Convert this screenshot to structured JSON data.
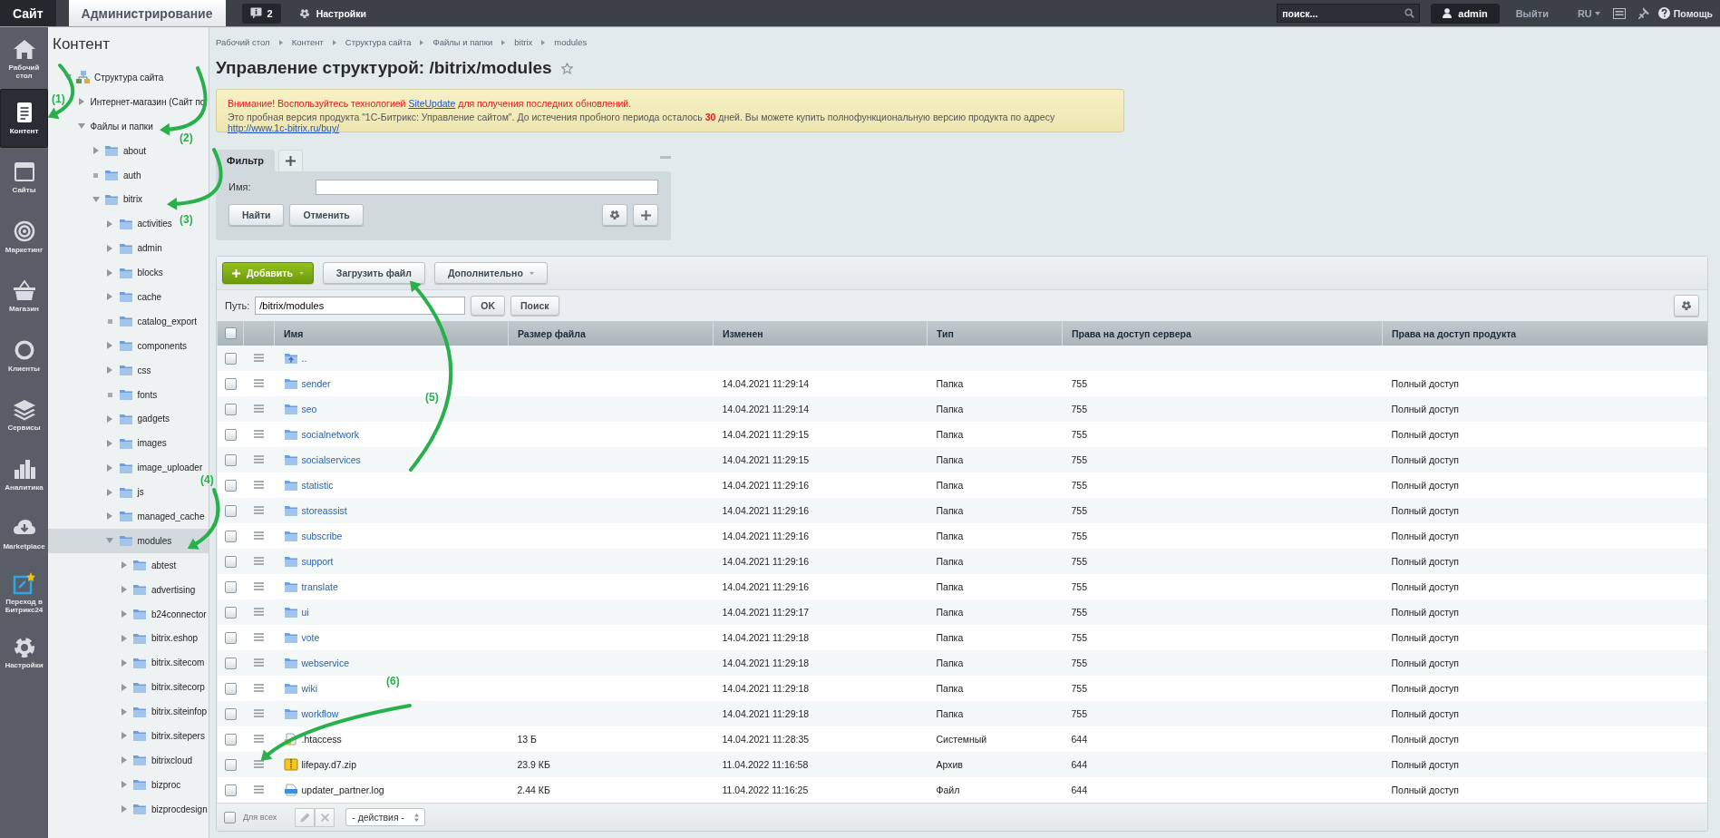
{
  "topbar": {
    "tabs": [
      {
        "label": "Сайт",
        "selected": false
      },
      {
        "label": "Администрирование",
        "selected": true
      }
    ],
    "notifications": {
      "count": "2"
    },
    "settings": "Настройки",
    "search": {
      "placeholder": "поиск..."
    },
    "user": "admin",
    "logout": "Выйти",
    "language": "RU",
    "help": "Помощь"
  },
  "nav": {
    "items": [
      {
        "label": "Рабочий стол",
        "selected": false
      },
      {
        "label": "Контент",
        "selected": true
      },
      {
        "label": "Сайты",
        "selected": false
      },
      {
        "label": "Маркетинг",
        "selected": false
      },
      {
        "label": "Магазин",
        "selected": false
      },
      {
        "label": "Клиенты",
        "selected": false
      },
      {
        "label": "Сервисы",
        "selected": false
      },
      {
        "label": "Аналитика",
        "selected": false
      },
      {
        "label": "Marketplace",
        "selected": false
      },
      {
        "label": "Переход в Битрикс24",
        "selected": false
      },
      {
        "label": "Настройки",
        "selected": false
      }
    ]
  },
  "tree": {
    "title": "Контент",
    "items": [
      {
        "label": "Структура сайта",
        "kind": "site",
        "expanded": true,
        "selected": false,
        "children": [
          {
            "label": "Интернет-магазин (Сайт по",
            "kind": "section",
            "expanded": false,
            "selected": false
          },
          {
            "label": "Файлы и папки",
            "kind": "section",
            "expanded": true,
            "selected": false,
            "children": [
              {
                "label": "about",
                "kind": "folder",
                "expanded": false,
                "selected": false
              },
              {
                "label": "auth",
                "kind": "leaf",
                "selected": false
              },
              {
                "label": "bitrix",
                "kind": "folder",
                "expanded": true,
                "selected": false,
                "children": [
                  {
                    "label": "activities",
                    "kind": "folder",
                    "expanded": false,
                    "selected": false
                  },
                  {
                    "label": "admin",
                    "kind": "folder",
                    "expanded": false,
                    "selected": false
                  },
                  {
                    "label": "blocks",
                    "kind": "folder",
                    "expanded": false,
                    "selected": false
                  },
                  {
                    "label": "cache",
                    "kind": "folder",
                    "expanded": false,
                    "selected": false
                  },
                  {
                    "label": "catalog_export",
                    "kind": "leaf",
                    "selected": false
                  },
                  {
                    "label": "components",
                    "kind": "folder",
                    "expanded": false,
                    "selected": false
                  },
                  {
                    "label": "css",
                    "kind": "folder",
                    "expanded": false,
                    "selected": false
                  },
                  {
                    "label": "fonts",
                    "kind": "leaf",
                    "selected": false
                  },
                  {
                    "label": "gadgets",
                    "kind": "folder",
                    "expanded": false,
                    "selected": false
                  },
                  {
                    "label": "images",
                    "kind": "folder",
                    "expanded": false,
                    "selected": false
                  },
                  {
                    "label": "image_uploader",
                    "kind": "folder",
                    "expanded": false,
                    "selected": false
                  },
                  {
                    "label": "js",
                    "kind": "folder",
                    "expanded": false,
                    "selected": false
                  },
                  {
                    "label": "managed_cache",
                    "kind": "folder",
                    "expanded": false,
                    "selected": false
                  },
                  {
                    "label": "modules",
                    "kind": "folder",
                    "expanded": true,
                    "selected": true,
                    "children": [
                      {
                        "label": "abtest",
                        "kind": "folder",
                        "expanded": false,
                        "selected": false
                      },
                      {
                        "label": "advertising",
                        "kind": "folder",
                        "expanded": false,
                        "selected": false
                      },
                      {
                        "label": "b24connector",
                        "kind": "folder",
                        "expanded": false,
                        "selected": false
                      },
                      {
                        "label": "bitrix.eshop",
                        "kind": "folder",
                        "expanded": false,
                        "selected": false
                      },
                      {
                        "label": "bitrix.sitecom",
                        "kind": "folder",
                        "expanded": false,
                        "selected": false
                      },
                      {
                        "label": "bitrix.sitecorp",
                        "kind": "folder",
                        "expanded": false,
                        "selected": false
                      },
                      {
                        "label": "bitrix.siteinfop",
                        "kind": "folder",
                        "expanded": false,
                        "selected": false
                      },
                      {
                        "label": "bitrix.sitepers",
                        "kind": "folder",
                        "expanded": false,
                        "selected": false
                      },
                      {
                        "label": "bitrixcloud",
                        "kind": "folder",
                        "expanded": false,
                        "selected": false
                      },
                      {
                        "label": "bizproc",
                        "kind": "folder",
                        "expanded": false,
                        "selected": false
                      },
                      {
                        "label": "bizprocdesign",
                        "kind": "folder",
                        "expanded": false,
                        "selected": false
                      }
                    ]
                  }
                ]
              }
            ]
          }
        ]
      }
    ]
  },
  "breadcrumbs": [
    "Рабочий стол",
    "Контент",
    "Структура сайта",
    "Файлы и папки",
    "bitrix",
    "modules"
  ],
  "page_title": "Управление структурой: /bitrix/modules",
  "notice": {
    "warning": {
      "before": "Внимание! Воспользуйтесь технологией ",
      "link": "SiteUpdate",
      "after": " для получения последних обновлений."
    },
    "trial": {
      "text": "Это пробная версия продукта \"1С-Битрикс: Управление сайтом\". До истечения пробного периода осталось **30** дней. Вы можете купить полнофункциональную версию продукта по адресу",
      "link": "http://www.1c-bitrix.ru/buy/"
    }
  },
  "filter": {
    "tabs": [
      {
        "label": "Фильтр",
        "selected": true
      }
    ],
    "fields": [
      {
        "label": "Имя:"
      }
    ],
    "buttons": [
      "Найти",
      "Отменить"
    ]
  },
  "toolbar": {
    "buttons": [
      {
        "label": "Добавить",
        "kind": "primary"
      },
      {
        "label": "Загрузить файл",
        "kind": "plain"
      },
      {
        "label": "Дополнительно",
        "kind": "menu"
      }
    ]
  },
  "path_bar": {
    "label": "Путь:",
    "value": "/bitrix/modules",
    "buttons": [
      "OK",
      "Поиск"
    ]
  },
  "table": {
    "columns": [
      "Имя",
      "Размер файла",
      "Изменен",
      "Тип",
      "Права на доступ сервера",
      "Права на доступ продукта"
    ],
    "select_all_checked": false,
    "rows": [
      {
        "kind": "parent",
        "name": "..",
        "checked": false
      },
      {
        "kind": "folder",
        "name": "sender",
        "modified": "14.04.2021 11:29:14",
        "type": "Папка",
        "server_rights": "755",
        "product_rights": "Полный доступ",
        "checked": false
      },
      {
        "kind": "folder",
        "name": "seo",
        "modified": "14.04.2021 11:29:14",
        "type": "Папка",
        "server_rights": "755",
        "product_rights": "Полный доступ",
        "checked": false
      },
      {
        "kind": "folder",
        "name": "socialnetwork",
        "modified": "14.04.2021 11:29:15",
        "type": "Папка",
        "server_rights": "755",
        "product_rights": "Полный доступ",
        "checked": false
      },
      {
        "kind": "folder",
        "name": "socialservices",
        "modified": "14.04.2021 11:29:15",
        "type": "Папка",
        "server_rights": "755",
        "product_rights": "Полный доступ",
        "checked": false
      },
      {
        "kind": "folder",
        "name": "statistic",
        "modified": "14.04.2021 11:29:16",
        "type": "Папка",
        "server_rights": "755",
        "product_rights": "Полный доступ",
        "checked": false
      },
      {
        "kind": "folder",
        "name": "storeassist",
        "modified": "14.04.2021 11:29:16",
        "type": "Папка",
        "server_rights": "755",
        "product_rights": "Полный доступ",
        "checked": false
      },
      {
        "kind": "folder",
        "name": "subscribe",
        "modified": "14.04.2021 11:29:16",
        "type": "Папка",
        "server_rights": "755",
        "product_rights": "Полный доступ",
        "checked": false
      },
      {
        "kind": "folder",
        "name": "support",
        "modified": "14.04.2021 11:29:16",
        "type": "Папка",
        "server_rights": "755",
        "product_rights": "Полный доступ",
        "checked": false
      },
      {
        "kind": "folder",
        "name": "translate",
        "modified": "14.04.2021 11:29:16",
        "type": "Папка",
        "server_rights": "755",
        "product_rights": "Полный доступ",
        "checked": false
      },
      {
        "kind": "folder",
        "name": "ui",
        "modified": "14.04.2021 11:29:17",
        "type": "Папка",
        "server_rights": "755",
        "product_rights": "Полный доступ",
        "checked": false
      },
      {
        "kind": "folder",
        "name": "vote",
        "modified": "14.04.2021 11:29:18",
        "type": "Папка",
        "server_rights": "755",
        "product_rights": "Полный доступ",
        "checked": false
      },
      {
        "kind": "folder",
        "name": "webservice",
        "modified": "14.04.2021 11:29:18",
        "type": "Папка",
        "server_rights": "755",
        "product_rights": "Полный доступ",
        "checked": false
      },
      {
        "kind": "folder",
        "name": "wiki",
        "modified": "14.04.2021 11:29:18",
        "type": "Папка",
        "server_rights": "755",
        "product_rights": "Полный доступ",
        "checked": false
      },
      {
        "kind": "folder",
        "name": "workflow",
        "modified": "14.04.2021 11:29:18",
        "type": "Папка",
        "server_rights": "755",
        "product_rights": "Полный доступ",
        "checked": false
      },
      {
        "kind": "system",
        "name": ".htaccess",
        "size": "13 Б",
        "modified": "14.04.2021 11:28:35",
        "type": "Системный",
        "server_rights": "644",
        "product_rights": "Полный доступ",
        "checked": false
      },
      {
        "kind": "archive",
        "name": "lifepay.d7.zip",
        "size": "23.9 КБ",
        "modified": "11.04.2022 11:16:58",
        "type": "Архив",
        "server_rights": "644",
        "product_rights": "Полный доступ",
        "checked": false
      },
      {
        "kind": "log",
        "name": "updater_partner.log",
        "size": "2.44 КБ",
        "modified": "11.04.2022 11:16:25",
        "type": "Файл",
        "server_rights": "644",
        "product_rights": "Полный доступ",
        "checked": false
      }
    ]
  },
  "footer": {
    "for_all": {
      "label": "Для всех",
      "checked": false
    },
    "actions": "- действия -"
  },
  "annotations": [
    {
      "label": "(1)"
    },
    {
      "label": "(2)"
    },
    {
      "label": "(3)"
    },
    {
      "label": "(4)"
    },
    {
      "label": "(5)"
    },
    {
      "label": "(6)"
    }
  ]
}
